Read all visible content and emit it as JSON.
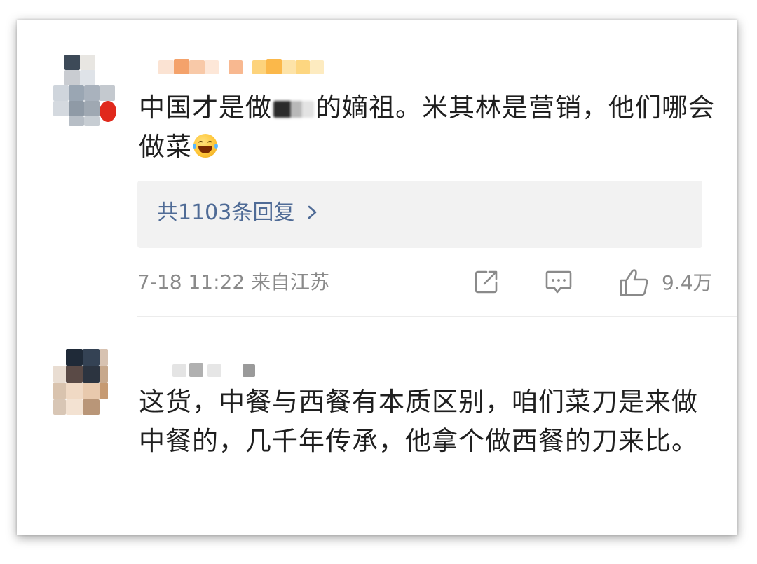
{
  "comments": [
    {
      "text_before": "中国才是做",
      "text_after": "的嫡祖。米其林是营销，他们哪会做菜",
      "emoji": "laughing-emoji",
      "replies_label": "共1103条回复",
      "timestamp": "7-18 11:22",
      "location": "来自江苏",
      "like_count": "9.4万"
    },
    {
      "text": "这货，中餐与西餐有本质区别，咱们菜刀是来做中餐的，几千年传承，他拿个做西餐的刀来比。"
    }
  ],
  "icons": {
    "share": "share-icon",
    "comment": "comment-icon",
    "like": "thumbs-up-icon",
    "reply_chevron": "chevron-right-icon"
  },
  "colors": {
    "link": "#4f6b96",
    "meta_text": "#8a8a8a",
    "reply_box_bg": "#f2f2f2"
  }
}
